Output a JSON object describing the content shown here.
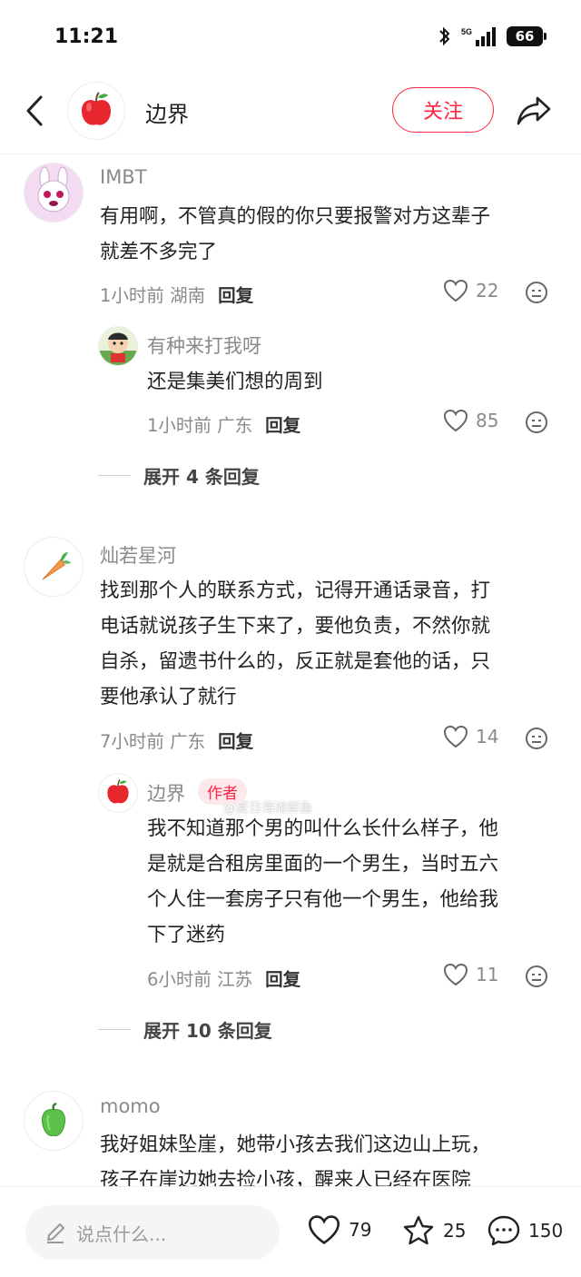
{
  "status_bar": {
    "time": "11:21",
    "network": "5G",
    "battery": "66"
  },
  "header": {
    "title": "边界",
    "follow_label": "关注"
  },
  "comments": [
    {
      "user": "IMBT",
      "text_lines": [
        "有用啊，不管真的假的你只要报警对方这辈子",
        "就差不多完了"
      ],
      "time": "1小时前",
      "location": "湖南",
      "reply_label": "回复",
      "likes": "22",
      "replies": [
        {
          "user": "有种来打我呀",
          "text_lines": [
            "还是集美们想的周到"
          ],
          "time": "1小时前",
          "location": "广东",
          "reply_label": "回复",
          "likes": "85"
        }
      ],
      "expand_label": "展开 4 条回复"
    },
    {
      "user": "灿若星河",
      "text_lines": [
        "找到那个人的联系方式，记得开通话录音，打",
        "电话就说孩子生下来了，要他负责，不然你就",
        "自杀，留遗书什么的，反正就是套他的话，只",
        "要他承认了就行"
      ],
      "time": "7小时前",
      "location": "广东",
      "reply_label": "回复",
      "likes": "14",
      "replies": [
        {
          "user": "边界",
          "author_tag": "作者",
          "text_lines": [
            "我不知道那个男的叫什么长什么样子，他",
            "是就是合租房里面的一个男生，当时五六",
            "个人住一套房子只有他一个男生，他给我",
            "下了迷药"
          ],
          "time": "6小时前",
          "location": "江苏",
          "reply_label": "回复",
          "likes": "11"
        }
      ],
      "expand_label": "展开 10 条回复"
    },
    {
      "user": "momo",
      "text_lines": [
        "我好姐妹坠崖，她带小孩去我们这边山上玩，",
        "孩子在崖边她去捡小孩，醒来人已经在医院"
      ]
    }
  ],
  "watermark": "@夏日海滩鲜鱼",
  "bottom_bar": {
    "placeholder": "说点什么...",
    "likes": "79",
    "stars": "25",
    "comments": "150"
  },
  "colors": {
    "accent": "#ff2442",
    "muted": "#8a8a8a"
  }
}
